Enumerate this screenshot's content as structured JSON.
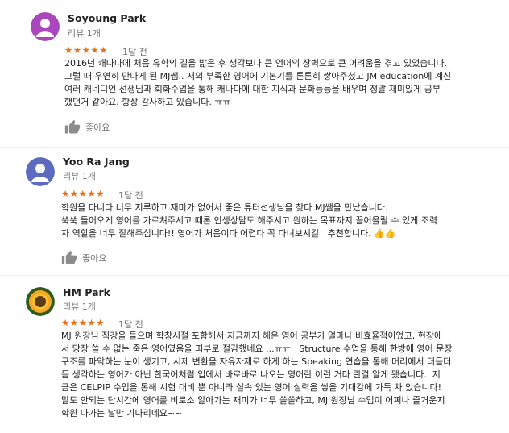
{
  "reviews": [
    {
      "name": "Soyoung Park",
      "review_count": "리뷰 1개",
      "stars": "★★★★★",
      "rating": 5,
      "time": "1달 전",
      "text": "2016년 캐나다에 처음 유학의 길을 밟은 후 생각보다 큰 언어의 장벽으로 큰 어려움을 겪고 있었습니다.\n그럴 때 우연히 만나게 된 MJ쌤.. 저의 부족한 영어에 기본기를 튼튼히 쌓아주셨고 JM education에 계신\n여러 캐네디언 선생님과 회화수업을 통해 캐나다에 대한 지식과 문화등등을 배우며 정말 재미있게 공부\n했던거 같아요. 항상 감사하고 있습니다. ㅠㅠ",
      "like_label": "좋아요",
      "avatar_color": "#ab47bc"
    },
    {
      "name": "Yoo Ra Jang",
      "review_count": "리뷰 1개",
      "stars": "★★★★★",
      "rating": 5,
      "time": "1달 전",
      "text": "학원을 다니다 너무 지루하고 재미가 없어서 좋은 튜터선생님을 찾다 MJ쌤을 만났습니다.\n쑥쑥 들어오게 영어를 가르쳐주시고 때론 인생상담도 해주시고 원하는 목표까지 끌어올릴 수 있게 조력\n자 역할을 너무 잘해주십니다!! 영어가 처음이다 어렵다 꼭 다녀보시길   추천합니다. 👍👍",
      "like_label": "좋아요",
      "avatar_color": "#5c6bc0"
    },
    {
      "name": "HM Park",
      "review_count": "리뷰 1개",
      "stars": "★★★★★",
      "rating": 5,
      "time": "1달 전",
      "text": "MJ 원장님 직강을 들으며 학창시절 포함해서 지금까지 해온 영어 공부가 얼마나 비효율적이었고, 현장에\n서 당장 쓸 수 없는 죽은 영어였음을 피부로 절감했네요 ...ㅠㅠ   Structure 수업을 통해 한방에 영어 문장\n구조를 파악하는 눈이 생기고, 시제 변환을 자유자재로 하게 하는 Speaking 연습을 통해 머리에서 더듬더\n듬 생각하는 영어가 아닌 한국어처럼 입에서 바로바로 나오는 영어란 이런 거다 란걸 알게 됐습니다.  지\n금은 CELPIP 수업을 통해 시험 대비 뿐 아니라 실속 있는 영어 실력을 쌓을 기대감에 가득 차 있습니다!\n말도 안되는 단시간에 영어를 비로소 알아가는 재미가 너무 쏠쏠하고, MJ 원장님 수업이 어쩌나 즐거운지\n학원 나가는 날만 기다리네요~~",
      "avatar_color": "#f9a825"
    }
  ]
}
